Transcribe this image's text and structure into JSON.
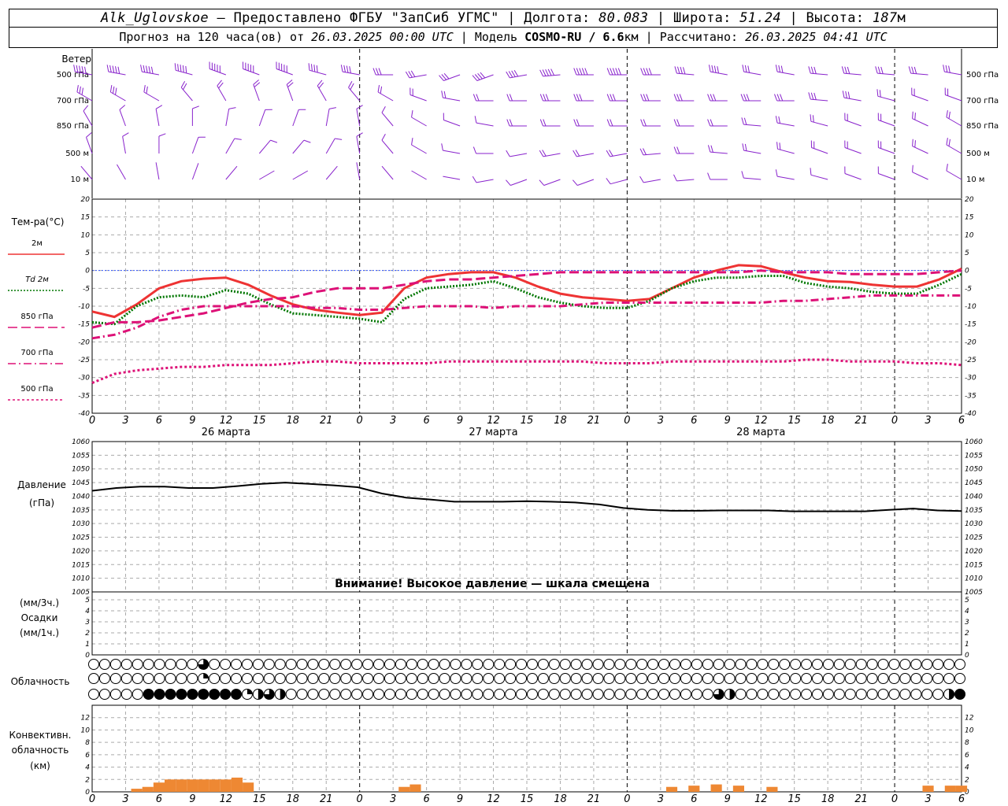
{
  "header": {
    "station": "Alk_Uglovskoe",
    "provider": "— Предоставлено ФГБУ \"ЗапСиб УГМС\"",
    "lon_label": "Долгота:",
    "lon": "80.083",
    "lat_label": "Широта:",
    "lat": "51.24",
    "alt_label": "Высота:",
    "alt": "187",
    "alt_unit": "м",
    "forecast_label": "Прогноз на 120 часа(ов) от",
    "forecast_start": "26.03.2025 00:00 UTC",
    "model_label": "Модель",
    "model": "COSMO-RU / 6.6",
    "model_unit": "км",
    "calc_label": "Рассчитано:",
    "calc_time": "26.03.2025 04:41 UTC"
  },
  "labels": {
    "wind": "Ветер",
    "levels": [
      "500 гПа",
      "700 гПа",
      "850 гПа",
      "500 м",
      "10  м"
    ],
    "temp_title": "Тем-ра(°C)",
    "legend": [
      {
        "name": "2м",
        "color": "#ee3333",
        "dash": ""
      },
      {
        "name": "Td  2м",
        "color": "#007700",
        "dash": "2,2"
      },
      {
        "name": "850 гПа",
        "color": "#dd1177",
        "dash": "12,5"
      },
      {
        "name": "700 гПа",
        "color": "#dd1177",
        "dash": "10,4,2,4"
      },
      {
        "name": "500 гПа",
        "color": "#dd1177",
        "dash": "3,3"
      }
    ],
    "pressure_title": "Давление",
    "pressure_unit": "(гПа)",
    "pressure_warning": "Внимание! Высокое давление — шкала смещена",
    "precip_unit3": "(мм/3ч.)",
    "precip_title": "Осадки",
    "precip_unit1": "(мм/1ч.)",
    "clouds_title": "Облачность",
    "conv_title1": "Конвективн.",
    "conv_title2": "облачность",
    "conv_unit": "(км)"
  },
  "chart_data": {
    "type": "line",
    "x_hours": [
      0,
      3,
      6,
      9,
      12,
      15,
      18,
      21,
      24,
      27,
      30,
      33,
      36,
      39,
      42,
      45,
      48,
      51,
      54,
      57,
      60,
      63,
      66,
      69,
      72,
      75,
      78
    ],
    "x_tick_labels": [
      "0",
      "3",
      "6",
      "9",
      "12",
      "15",
      "18",
      "21",
      "0",
      "3",
      "6",
      "9",
      "12",
      "15",
      "18",
      "21",
      "0",
      "3",
      "6",
      "9",
      "12",
      "15",
      "18",
      "21",
      "0",
      "3",
      "6"
    ],
    "day_labels": [
      "26 марта",
      "27 марта",
      "28 марта"
    ],
    "day_label_hours": [
      12,
      36,
      60
    ],
    "day_boundaries": [
      24,
      48,
      72
    ],
    "temperature": {
      "ylim": [
        -40,
        20
      ],
      "ticks": [
        20,
        15,
        10,
        5,
        0,
        -5,
        -10,
        -15,
        -20,
        -25,
        -30,
        -35,
        -40
      ],
      "series": [
        {
          "name": "2м",
          "color": "#ee3333",
          "values": [
            -11.5,
            -13,
            -9.5,
            -5,
            -3,
            -2.3,
            -2,
            -4,
            -7,
            -9.5,
            -11,
            -11.8,
            -12.5,
            -11.8,
            -5,
            -2,
            -1,
            -0.5,
            -0.5,
            -2,
            -4.5,
            -6.5,
            -7.5,
            -8,
            -8.5,
            -8,
            -5,
            -2,
            0,
            1.5,
            1.2,
            -0.5,
            -2,
            -3,
            -3.2,
            -4,
            -4.5,
            -4.5,
            -2.5,
            0.5
          ]
        },
        {
          "name": "Td  2м",
          "color": "#007700",
          "values": [
            -14.5,
            -15,
            -10,
            -7.5,
            -7,
            -7.5,
            -5.5,
            -6.5,
            -9.5,
            -12,
            -12.5,
            -13,
            -13.5,
            -14.5,
            -8,
            -5,
            -4.5,
            -4,
            -3,
            -5,
            -7.5,
            -9,
            -10,
            -10.5,
            -10.5,
            -8.5,
            -5,
            -3,
            -2,
            -2,
            -1.5,
            -1.5,
            -3.5,
            -4.5,
            -5,
            -6,
            -6.5,
            -6.5,
            -4,
            -1
          ]
        },
        {
          "name": "850 гПа",
          "color": "#dd1177",
          "values": [
            -16,
            -14.5,
            -14.5,
            -14,
            -13,
            -12,
            -10.5,
            -9,
            -8,
            -7.5,
            -6,
            -5,
            -5,
            -5,
            -4,
            -3,
            -2.5,
            -2.5,
            -2,
            -1.5,
            -1,
            -0.5,
            -0.5,
            -0.5,
            -0.5,
            -0.5,
            -0.5,
            -0.5,
            -0.5,
            -0.5,
            0,
            -0.5,
            -0.5,
            -0.5,
            -1,
            -1,
            -1,
            -1,
            -0.5,
            0
          ]
        },
        {
          "name": "700 гПа",
          "color": "#dd1177",
          "values": [
            -19,
            -18,
            -16,
            -13,
            -11,
            -10,
            -10,
            -10,
            -10,
            -10,
            -10.5,
            -10.5,
            -11,
            -11,
            -10.5,
            -10,
            -10,
            -10,
            -10.5,
            -10,
            -10,
            -10,
            -9.5,
            -9,
            -9,
            -9,
            -9,
            -9,
            -9,
            -9,
            -9,
            -8.5,
            -8.5,
            -8,
            -7.5,
            -7,
            -7,
            -7,
            -7,
            -7
          ]
        },
        {
          "name": "500 гПа",
          "color": "#dd1177",
          "values": [
            -31.5,
            -29,
            -28,
            -27.5,
            -27,
            -27,
            -26.5,
            -26.5,
            -26.5,
            -26,
            -25.5,
            -25.5,
            -26,
            -26,
            -26,
            -26,
            -25.5,
            -25.5,
            -25.5,
            -25.5,
            -25.5,
            -25.5,
            -25.5,
            -26,
            -26,
            -26,
            -25.5,
            -25.5,
            -25.5,
            -25.5,
            -25.5,
            -25.5,
            -25,
            -25,
            -25.5,
            -25.5,
            -25.5,
            -26,
            -26,
            -26.5
          ]
        }
      ]
    },
    "pressure": {
      "ylim": [
        1005,
        1060
      ],
      "ticks": [
        1060,
        1055,
        1050,
        1045,
        1040,
        1035,
        1030,
        1025,
        1020,
        1015,
        1010,
        1005
      ],
      "values": [
        1042,
        1043,
        1043.5,
        1043.5,
        1043,
        1043,
        1043.7,
        1044.5,
        1045,
        1044.5,
        1044,
        1043.3,
        1041,
        1039.5,
        1038.8,
        1038,
        1038,
        1038,
        1038.2,
        1038,
        1037.7,
        1037,
        1035.7,
        1035,
        1034.7,
        1034.7,
        1034.8,
        1034.8,
        1034.8,
        1034.5,
        1034.5,
        1034.5,
        1034.5,
        1035,
        1035.5,
        1034.8,
        1034.6
      ]
    },
    "precip": {
      "ylim": [
        0,
        5
      ],
      "ticks": [
        5,
        4,
        3,
        2,
        1,
        0
      ],
      "values": [
        0,
        0,
        0,
        0,
        0,
        0,
        0,
        0,
        0,
        0,
        0,
        0,
        0,
        0,
        0,
        0,
        0,
        0,
        0,
        0,
        0,
        0,
        0,
        0,
        0,
        0,
        0
      ]
    },
    "clouds": {
      "rows": 3,
      "note": "cover per 1h step: 0=clear, 1=quarter, 2=half, 3=three-quarter, 4=overcast",
      "high": {
        "10": 3
      },
      "middle": {
        "10": 1
      },
      "low": {
        "5": 4,
        "6": 4,
        "7": 4,
        "8": 4,
        "9": 4,
        "10": 4,
        "11": 4,
        "12": 4,
        "13": 4,
        "14": 1,
        "15": 2,
        "16": 3,
        "17": 2,
        "57": 3,
        "58": 2,
        "78": 2,
        "79": 4
      }
    },
    "convective": {
      "ylim": [
        0,
        14
      ],
      "ticks": [
        12,
        10,
        8,
        6,
        4,
        2,
        0
      ],
      "values": [
        [
          4,
          0.5
        ],
        [
          5,
          0.8
        ],
        [
          6,
          1.5
        ],
        [
          7,
          2
        ],
        [
          8,
          2
        ],
        [
          9,
          2
        ],
        [
          10,
          2
        ],
        [
          11,
          2
        ],
        [
          12,
          2
        ],
        [
          13,
          2.3
        ],
        [
          14,
          1.5
        ],
        [
          15,
          0
        ],
        [
          28,
          0.8
        ],
        [
          29,
          1.2
        ],
        [
          30,
          0
        ],
        [
          52,
          0.8
        ],
        [
          54,
          1
        ],
        [
          56,
          1.2
        ],
        [
          58,
          1
        ],
        [
          59,
          0
        ],
        [
          60,
          0
        ],
        [
          61,
          0.8
        ],
        [
          62,
          0
        ],
        [
          75,
          1
        ],
        [
          77,
          1
        ],
        [
          78,
          1
        ]
      ]
    },
    "wind": {
      "color": "#8822cc",
      "levels": [
        "500 гПа",
        "700 гПа",
        "850 гПа",
        "500 м",
        "10  м"
      ],
      "speed_ms": [
        [
          25,
          25,
          25,
          25,
          25,
          25,
          25,
          22,
          20,
          18,
          15,
          15,
          20,
          22,
          25,
          25,
          25,
          22,
          20,
          20,
          18,
          18,
          15,
          15,
          15,
          15,
          15
        ],
        [
          15,
          15,
          12,
          10,
          10,
          10,
          10,
          10,
          10,
          10,
          10,
          10,
          12,
          12,
          15,
          15,
          15,
          15,
          15,
          15,
          15,
          15,
          15,
          15,
          12,
          12,
          12
        ],
        [
          5,
          5,
          5,
          5,
          5,
          5,
          5,
          5,
          5,
          5,
          5,
          5,
          8,
          10,
          10,
          12,
          12,
          12,
          12,
          12,
          12,
          12,
          10,
          10,
          10,
          10,
          10
        ],
        [
          5,
          5,
          5,
          5,
          5,
          5,
          5,
          5,
          5,
          5,
          5,
          5,
          8,
          8,
          10,
          12,
          12,
          12,
          10,
          10,
          10,
          10,
          10,
          10,
          10,
          10,
          10
        ],
        [
          3,
          3,
          3,
          3,
          3,
          3,
          3,
          3,
          3,
          3,
          3,
          3,
          5,
          5,
          5,
          8,
          8,
          8,
          8,
          8,
          8,
          8,
          8,
          8,
          8,
          8,
          8
        ]
      ],
      "dir_deg": [
        [
          280,
          280,
          280,
          285,
          290,
          290,
          290,
          285,
          280,
          270,
          260,
          250,
          250,
          260,
          265,
          270,
          270,
          270,
          275,
          280,
          280,
          280,
          275,
          275,
          275,
          275,
          280
        ],
        [
          300,
          300,
          300,
          320,
          330,
          340,
          340,
          330,
          320,
          300,
          290,
          280,
          270,
          270,
          270,
          270,
          270,
          270,
          270,
          270,
          270,
          270,
          275,
          280,
          285,
          290,
          290
        ],
        [
          330,
          340,
          350,
          0,
          10,
          20,
          20,
          10,
          350,
          320,
          300,
          290,
          280,
          270,
          270,
          270,
          270,
          270,
          270,
          270,
          275,
          280,
          285,
          290,
          290,
          295,
          300
        ],
        [
          340,
          350,
          0,
          20,
          30,
          40,
          40,
          30,
          350,
          320,
          300,
          280,
          270,
          260,
          260,
          260,
          260,
          265,
          270,
          275,
          280,
          285,
          290,
          290,
          290,
          295,
          300
        ],
        [
          320,
          330,
          350,
          20,
          40,
          60,
          60,
          40,
          350,
          320,
          300,
          280,
          260,
          250,
          250,
          250,
          255,
          260,
          265,
          270,
          275,
          280,
          285,
          290,
          290,
          295,
          300
        ]
      ]
    }
  }
}
